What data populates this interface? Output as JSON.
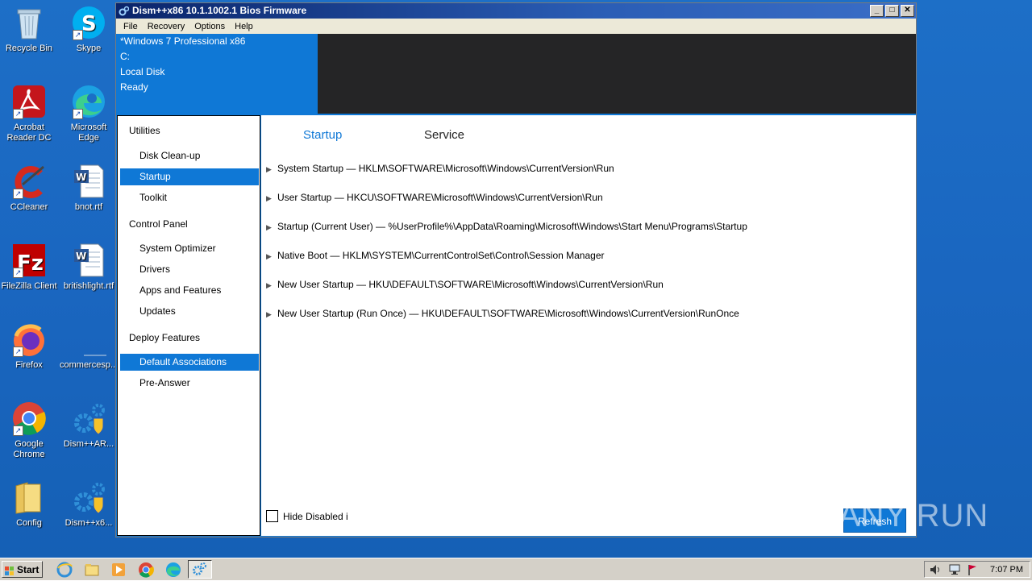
{
  "desktop": {
    "icons": [
      {
        "label": "Recycle Bin"
      },
      {
        "label": "Skype"
      },
      {
        "label": "Acrobat Reader DC"
      },
      {
        "label": "Microsoft Edge"
      },
      {
        "label": "CCleaner"
      },
      {
        "label": "bnot.rtf"
      },
      {
        "label": "FileZilla Client"
      },
      {
        "label": "britishlight.rtf"
      },
      {
        "label": "Firefox"
      },
      {
        "label": "commercesp..."
      },
      {
        "label": "Google Chrome"
      },
      {
        "label": "Dism++AR..."
      },
      {
        "label": "Config"
      },
      {
        "label": "Dism++x6..."
      }
    ]
  },
  "window": {
    "title": "Dism++x86 10.1.1002.1 Bios Firmware",
    "controls": {
      "minimize": "_",
      "maximize": "□",
      "close": "✕"
    }
  },
  "menu": [
    "File",
    "Recovery",
    "Options",
    "Help"
  ],
  "info": {
    "os": "*Windows 7 Professional x86",
    "drive": "C:",
    "disk": "Local Disk",
    "status": "Ready"
  },
  "sidebar": {
    "groups": [
      {
        "label": "Utilities",
        "items": [
          {
            "label": "Disk Clean-up",
            "selected": false
          },
          {
            "label": "Startup",
            "selected": true
          },
          {
            "label": "Toolkit",
            "selected": false
          }
        ]
      },
      {
        "label": "Control Panel",
        "items": [
          {
            "label": "System Optimizer",
            "selected": false
          },
          {
            "label": "Drivers",
            "selected": false
          },
          {
            "label": "Apps and Features",
            "selected": false
          },
          {
            "label": "Updates",
            "selected": false
          }
        ]
      },
      {
        "label": "Deploy Features",
        "items": [
          {
            "label": "Default Associations",
            "selected": true
          },
          {
            "label": "Pre-Answer",
            "selected": false
          }
        ]
      }
    ]
  },
  "main": {
    "tabs": [
      {
        "label": "Startup",
        "active": true
      },
      {
        "label": "Service",
        "active": false
      }
    ],
    "entries": [
      "System Startup — HKLM\\SOFTWARE\\Microsoft\\Windows\\CurrentVersion\\Run",
      "User Startup — HKCU\\SOFTWARE\\Microsoft\\Windows\\CurrentVersion\\Run",
      "Startup (Current User) — %UserProfile%\\AppData\\Roaming\\Microsoft\\Windows\\Start Menu\\Programs\\Startup",
      "Native Boot — HKLM\\SYSTEM\\CurrentControlSet\\Control\\Session Manager",
      "New User Startup — HKU\\DEFAULT\\SOFTWARE\\Microsoft\\Windows\\CurrentVersion\\Run",
      "New User Startup (Run Once) — HKU\\DEFAULT\\SOFTWARE\\Microsoft\\Windows\\CurrentVersion\\RunOnce"
    ],
    "hide_disabled_label": "Hide Disabled i",
    "hide_disabled_checked": false,
    "refresh_label": "Refresh"
  },
  "watermark": "ANY RUN",
  "taskbar": {
    "start_label": "Start",
    "clock": "7:07 PM"
  },
  "colors": {
    "accent": "#0f78d6",
    "desktop": "#1a66c0",
    "dark_panel": "#252526"
  }
}
